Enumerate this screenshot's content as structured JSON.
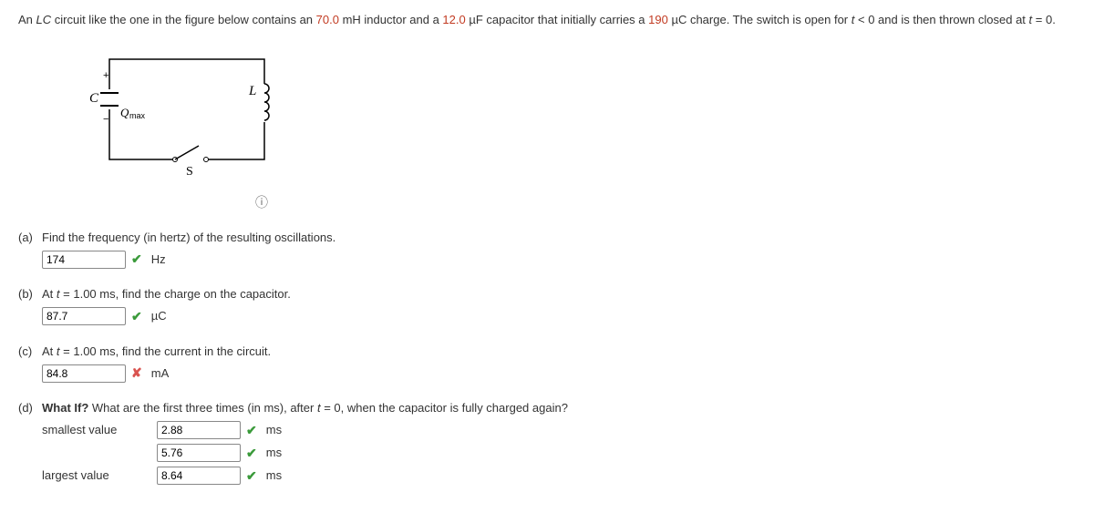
{
  "statement": {
    "p1": "An ",
    "p2": " circuit like the one in the figure below contains an ",
    "v1": "70.0",
    "p3": " mH inductor and a ",
    "v2": "12.0",
    "p4": " µF capacitor that initially carries a ",
    "v3": "190",
    "p5": " µC charge. The switch is open for ",
    "p6": " and is then thrown closed at "
  },
  "figure": {
    "C": "C",
    "L": "L",
    "S": "S",
    "Qmax": "max",
    "Q": "Q",
    "plus": "+",
    "minus": "−"
  },
  "parts": {
    "a": {
      "label": "(a)",
      "prompt": "Find the frequency (in hertz) of the resulting oscillations.",
      "value": "174",
      "unit": "Hz"
    },
    "b": {
      "label": "(b)",
      "prompt_pre": "At ",
      "prompt_post": ", find the charge on the capacitor.",
      "time": " = 1.00 ms",
      "value": "87.7",
      "unit": "µC"
    },
    "c": {
      "label": "(c)",
      "prompt_pre": "At ",
      "prompt_post": ", find the current in the circuit.",
      "time": " = 1.00 ms",
      "value": "84.8",
      "unit": "mA"
    },
    "d": {
      "label": "(d)",
      "prompt_pre": "What If?",
      "prompt_mid": " What are the first three times (in ms), after ",
      "prompt_post": " = 0, when the capacitor is fully charged again?",
      "smallest": "smallest value",
      "largest": "largest value",
      "v1": "2.88",
      "v2": "5.76",
      "v3": "8.64",
      "unit": "ms"
    }
  },
  "marks": {
    "check": "✔",
    "cross": "✘"
  },
  "info_icon": "ⓘ"
}
